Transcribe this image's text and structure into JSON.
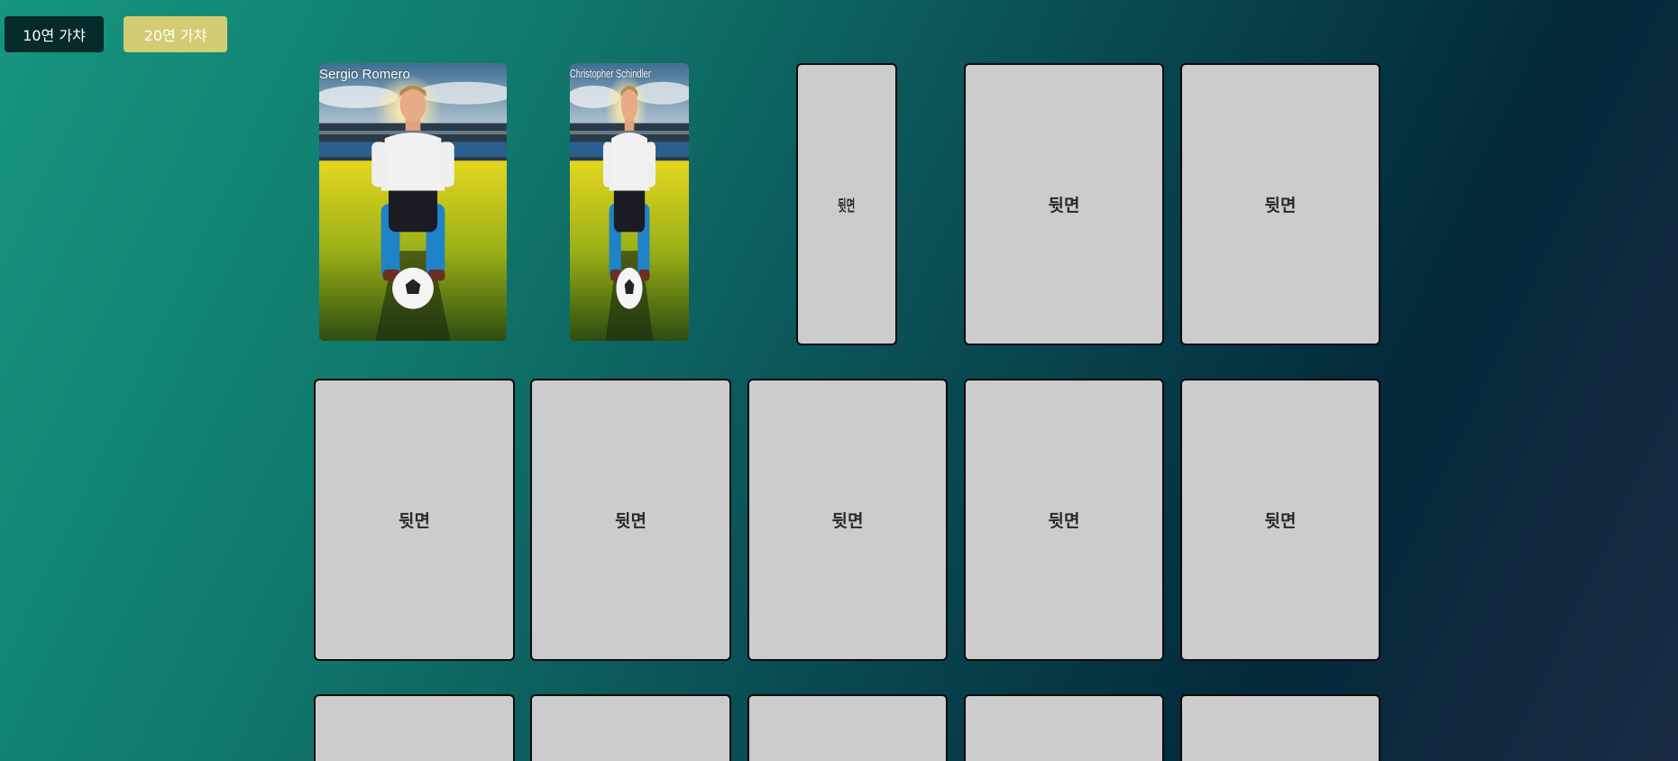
{
  "buttons": {
    "gacha_10": "10연 가챠",
    "gacha_20": "20연 가챠"
  },
  "revealed_cards": [
    {
      "name": "Sergio Romero"
    },
    {
      "name": "Christopher Schindler"
    }
  ],
  "card_back_label": "뒷면",
  "colors": {
    "card_back": "#cccccc",
    "button_dark": "#072a2a",
    "button_accent": "#d2cd74"
  }
}
